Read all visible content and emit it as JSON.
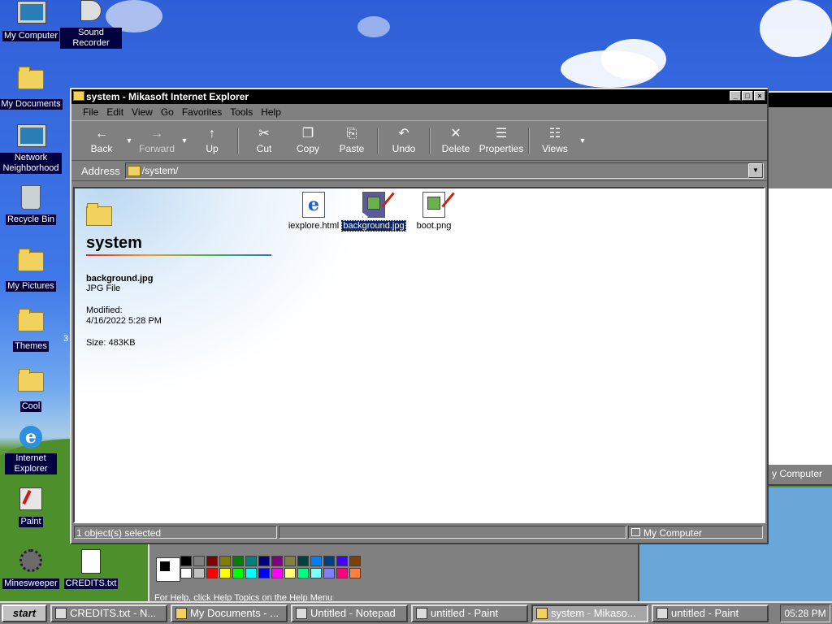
{
  "desktop": {
    "icons": [
      {
        "label": "My Computer"
      },
      {
        "label": "Sound Recorder"
      },
      {
        "label": "My Documents"
      },
      {
        "label": "Network Neighborhood"
      },
      {
        "label": "Recycle Bin"
      },
      {
        "label": "My Pictures"
      },
      {
        "label": "Themes"
      },
      {
        "label": "Cool"
      },
      {
        "label": "Internet Explorer"
      },
      {
        "label": "Paint"
      },
      {
        "label": "Minesweeper"
      },
      {
        "label": "CREDITS.txt"
      }
    ],
    "partial_label_3": "3"
  },
  "explorer": {
    "title": "system - Mikasoft Internet Explorer",
    "menu": [
      "File",
      "Edit",
      "View",
      "Go",
      "Favorites",
      "Tools",
      "Help"
    ],
    "toolbar": {
      "back": "Back",
      "forward": "Forward",
      "up": "Up",
      "cut": "Cut",
      "copy": "Copy",
      "paste": "Paste",
      "undo": "Undo",
      "delete": "Delete",
      "properties": "Properties",
      "views": "Views"
    },
    "address": {
      "label": "Address",
      "value": "/system/"
    },
    "panel": {
      "folder_title": "system",
      "file_name": "background.jpg",
      "file_type": "JPG File",
      "modified_label": "Modified:",
      "modified_value": "4/16/2022 5:28 PM",
      "size": "Size: 483KB"
    },
    "files": [
      {
        "name": "iexplore.html",
        "selected": false
      },
      {
        "name": "background.jpg",
        "selected": true
      },
      {
        "name": "boot.png",
        "selected": false
      }
    ],
    "status": {
      "left": "1 object(s) selected",
      "right": "My Computer"
    }
  },
  "background_window": {
    "status_text": "y Computer"
  },
  "paint": {
    "help": "For Help, click Help Topics on the Help Menu"
  },
  "palette_colors": [
    "#000000",
    "#808080",
    "#800000",
    "#808000",
    "#008000",
    "#008080",
    "#000080",
    "#800080",
    "#808040",
    "#004040",
    "#0080ff",
    "#004080",
    "#4000ff",
    "#804000",
    "#ffffff",
    "#c0c0c0",
    "#ff0000",
    "#ffff00",
    "#00ff00",
    "#00ffff",
    "#0000ff",
    "#ff00ff",
    "#ffff80",
    "#00ff80",
    "#80ffff",
    "#8080ff",
    "#ff0080",
    "#ff8040"
  ],
  "taskbar": {
    "start": "start",
    "tasks": [
      {
        "label": "CREDITS.txt - N..."
      },
      {
        "label": "My Documents - ..."
      },
      {
        "label": "Untitled - Notepad"
      },
      {
        "label": "untitled - Paint"
      },
      {
        "label": "system - Mikaso..."
      },
      {
        "label": "untitled - Paint"
      }
    ],
    "clock": "05:28 PM"
  }
}
